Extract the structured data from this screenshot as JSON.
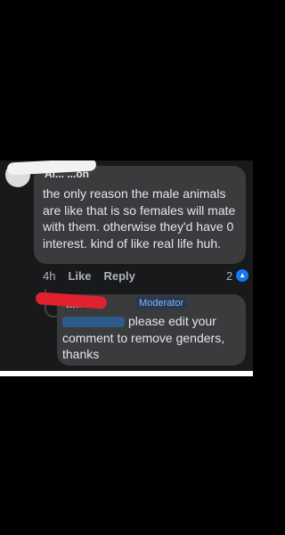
{
  "comment": {
    "author": "Al... ...on",
    "text": "the only reason the male animals are like that is so females will mate with them. otherwise they'd have 0 interest. kind of like real life huh.",
    "time": "4h",
    "like_label": "Like",
    "reply_label": "Reply",
    "reaction_count": "2",
    "reaction_icon": "like-thumb-icon"
  },
  "reply": {
    "author": "...lish",
    "badge": "Moderator",
    "text": "please edit your comment to remove genders, thanks"
  },
  "colors": {
    "background": "#000000",
    "panel": "#18191a",
    "bubble": "#3a3b3c",
    "text": "#e4e6eb",
    "muted": "#b0b3b8",
    "accent": "#1877f2"
  }
}
